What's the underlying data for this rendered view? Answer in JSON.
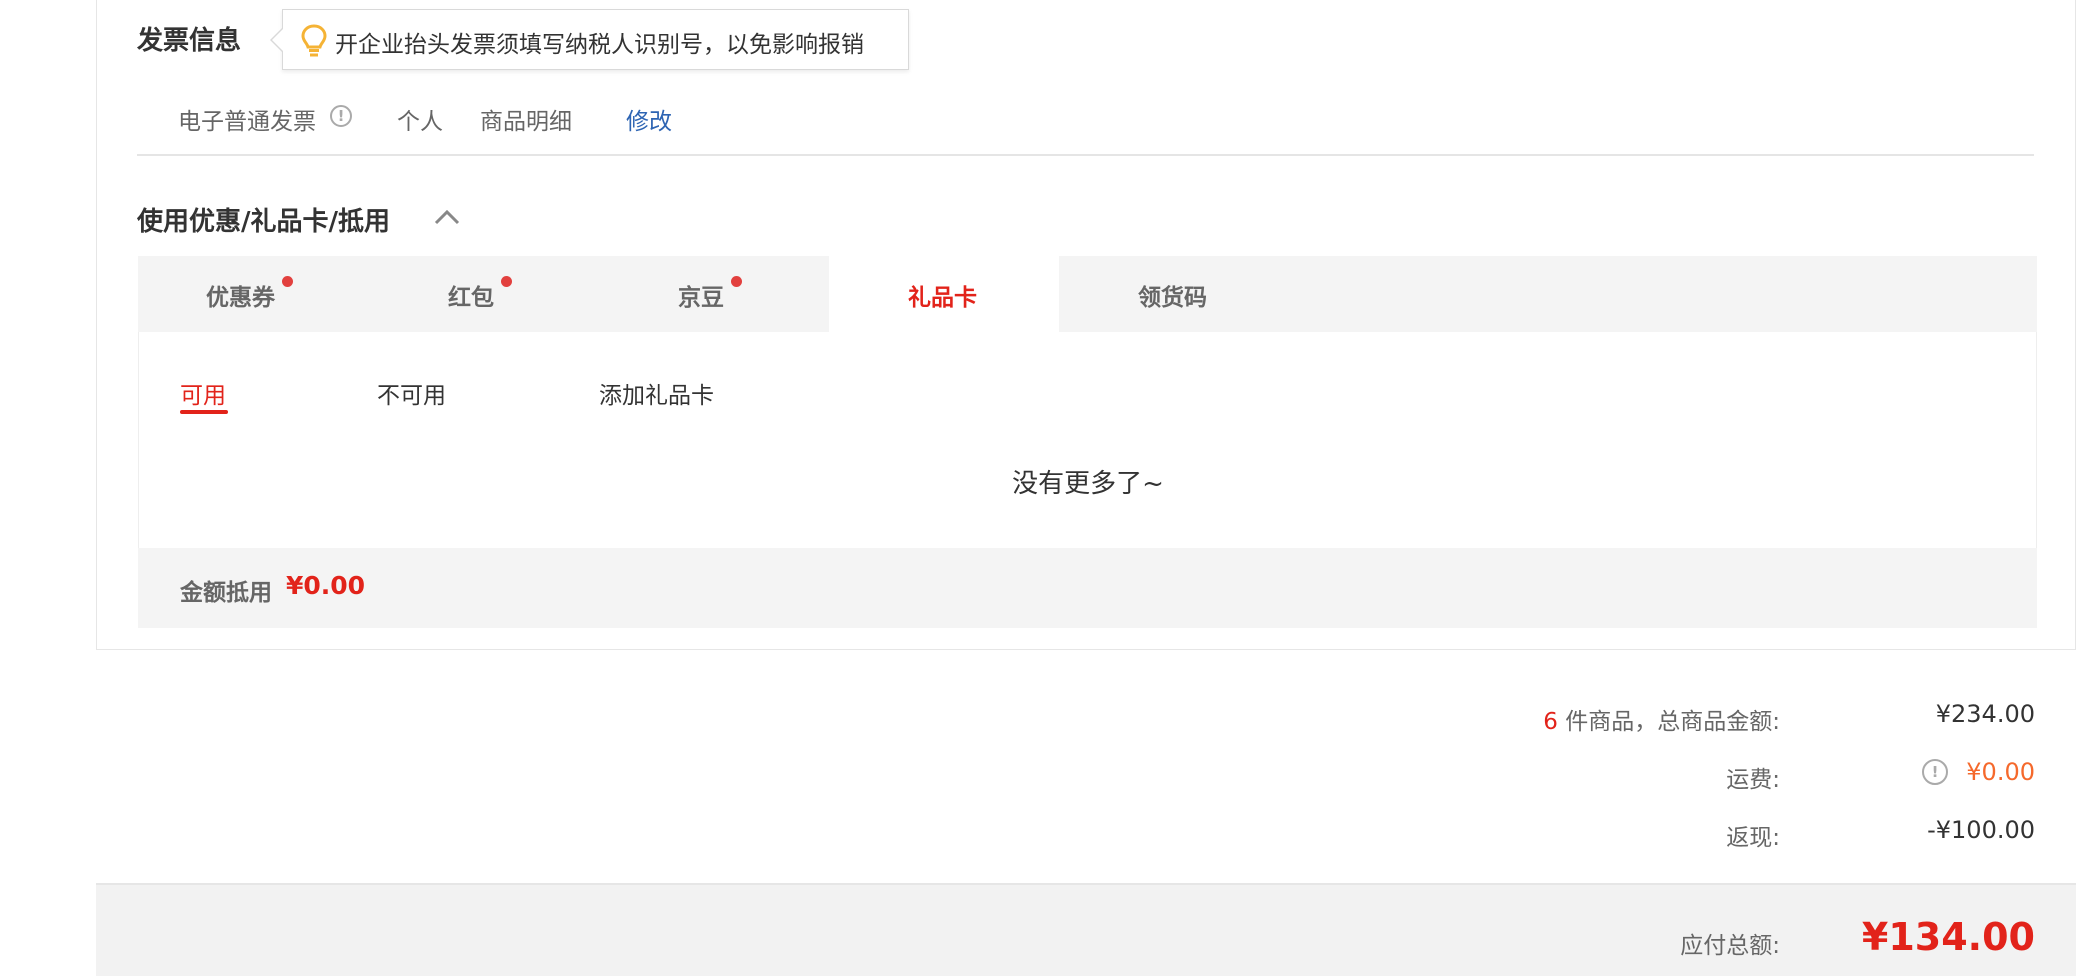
{
  "invoice": {
    "title": "发票信息",
    "tip": "开企业抬头发票须填写纳税人识别号，以免影响报销",
    "type": "电子普通发票",
    "title_type": "个人",
    "content": "商品明细",
    "edit_label": "修改"
  },
  "discount": {
    "title": "使用优惠/礼品卡/抵用",
    "tabs": [
      {
        "label": "优惠券",
        "dot": true
      },
      {
        "label": "红包",
        "dot": true
      },
      {
        "label": "京豆",
        "dot": true
      },
      {
        "label": "礼品卡",
        "dot": false,
        "active": true
      },
      {
        "label": "领货码",
        "dot": false
      }
    ],
    "sub_tabs": [
      "可用",
      "不可用",
      "添加礼品卡"
    ],
    "empty_text": "没有更多了~",
    "amount_label": "金额抵用",
    "amount_value": "¥0.00"
  },
  "summary": {
    "item_count": "6",
    "items_label": "件商品，总商品金额:",
    "items_total": "¥234.00",
    "shipping_label": "运费:",
    "shipping_value": "¥0.00",
    "cashback_label": "返现:",
    "cashback_value": "-¥100.00",
    "total_label": "应付总额:",
    "total_value": "¥134.00"
  },
  "colors": {
    "accent": "#e2231a",
    "link": "#2d64b3",
    "shipping": "#f5692c"
  }
}
